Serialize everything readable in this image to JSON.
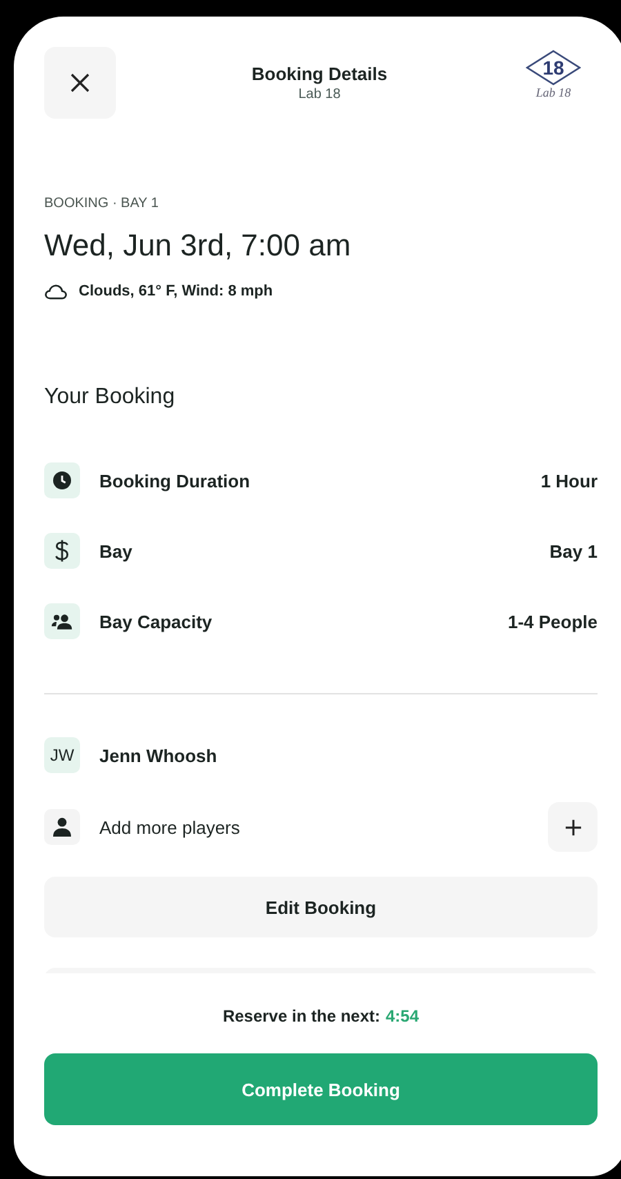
{
  "header": {
    "title": "Booking Details",
    "subtitle": "Lab 18",
    "logo": {
      "number": "18",
      "caption": "Lab 18"
    }
  },
  "booking": {
    "eyebrow": "BOOKING · BAY 1",
    "date": "Wed, Jun 3rd, 7:00 am",
    "weather": "Clouds, 61° F, Wind: 8 mph"
  },
  "section_title": "Your Booking",
  "details": [
    {
      "kind": "clock",
      "label": "Booking Duration",
      "value": "1 Hour"
    },
    {
      "kind": "dollar",
      "label": "Bay",
      "value": "Bay 1"
    },
    {
      "kind": "group",
      "label": "Bay Capacity",
      "value": "1-4 People"
    }
  ],
  "players": [
    {
      "kind": "initials",
      "initials": "JW",
      "name": "Jenn Whoosh"
    },
    {
      "kind": "add",
      "name": "Add more players"
    }
  ],
  "edit_button": "Edit Booking",
  "timer": {
    "label": "Reserve in the next:",
    "value": "4:54"
  },
  "complete_button": "Complete Booking"
}
